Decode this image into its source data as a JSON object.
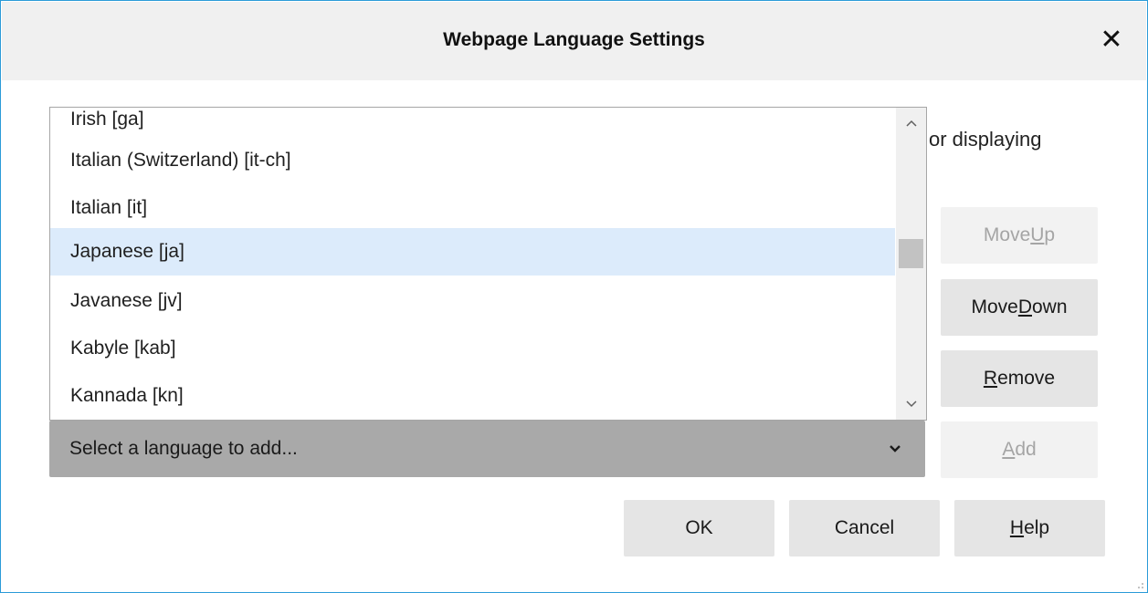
{
  "dialog": {
    "title": "Webpage Language Settings",
    "close_glyph": "✕",
    "background_text": "or displaying"
  },
  "language_list": {
    "items": [
      {
        "label": "Irish [ga]",
        "selected": false
      },
      {
        "label": "Italian (Switzerland) [it-ch]",
        "selected": false
      },
      {
        "label": "Italian [it]",
        "selected": false
      },
      {
        "label": "Japanese [ja]",
        "selected": true
      },
      {
        "label": "Javanese [jv]",
        "selected": false
      },
      {
        "label": "Kabyle [kab]",
        "selected": false
      },
      {
        "label": "Kannada [kn]",
        "selected": false
      }
    ],
    "scroll_up_icon": "chevron-up-icon",
    "scroll_down_icon": "chevron-down-icon"
  },
  "add_select": {
    "placeholder": "Select a language to add...",
    "icon": "chevron-down-icon"
  },
  "side_buttons": {
    "move_up": {
      "pre": "Move ",
      "mn": "U",
      "post": "p",
      "disabled": true
    },
    "move_down": {
      "pre": "Move ",
      "mn": "D",
      "post": "own",
      "disabled": false
    },
    "remove": {
      "pre": "",
      "mn": "R",
      "post": "emove",
      "disabled": false
    },
    "add": {
      "pre": "",
      "mn": "A",
      "post": "dd",
      "disabled": true
    }
  },
  "footer_buttons": {
    "ok": "OK",
    "cancel": "Cancel",
    "help": {
      "pre": "",
      "mn": "H",
      "post": "elp"
    }
  },
  "colors": {
    "selection": "#dcebfb",
    "window_border": "#2b9bd8",
    "select_bg": "#a9a9a9"
  }
}
